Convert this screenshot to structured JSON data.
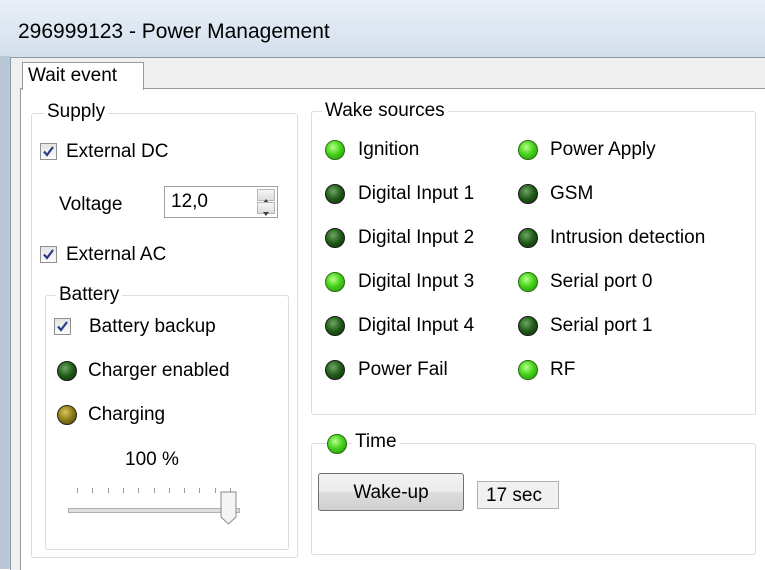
{
  "window": {
    "title": "296999123 - Power Management"
  },
  "tab": {
    "label": "Wait event"
  },
  "supply": {
    "title": "Supply",
    "external_dc": {
      "label": "External DC",
      "checked": true
    },
    "voltage": {
      "label": "Voltage",
      "value": "12,0"
    },
    "external_ac": {
      "label": "External AC",
      "checked": true
    }
  },
  "battery": {
    "title": "Battery",
    "backup": {
      "label": "Battery backup",
      "checked": true
    },
    "charger_enabled": {
      "label": "Charger enabled",
      "state": "off"
    },
    "charging": {
      "label": "Charging",
      "state": "amber"
    },
    "level": {
      "label": "100 %",
      "fraction": 1.0
    }
  },
  "wake_sources": {
    "title": "Wake sources",
    "left": [
      {
        "label": "Ignition",
        "state": "on"
      },
      {
        "label": "Digital Input 1",
        "state": "off"
      },
      {
        "label": "Digital Input 2",
        "state": "off"
      },
      {
        "label": "Digital Input 3",
        "state": "on"
      },
      {
        "label": "Digital Input 4",
        "state": "off"
      },
      {
        "label": "Power Fail",
        "state": "off"
      }
    ],
    "right": [
      {
        "label": "Power Apply",
        "state": "on"
      },
      {
        "label": "GSM",
        "state": "off"
      },
      {
        "label": "Intrusion detection",
        "state": "off"
      },
      {
        "label": "Serial port 0",
        "state": "on"
      },
      {
        "label": "Serial port 1",
        "state": "off"
      },
      {
        "label": "RF",
        "state": "on"
      }
    ]
  },
  "time": {
    "title": "Time",
    "state": "on",
    "wakeup_button": "Wake-up",
    "remaining": "17 sec"
  },
  "colors": {
    "led_on": "#47d41d",
    "led_off": "#1f5a16",
    "led_amber": "#8b7a16"
  }
}
